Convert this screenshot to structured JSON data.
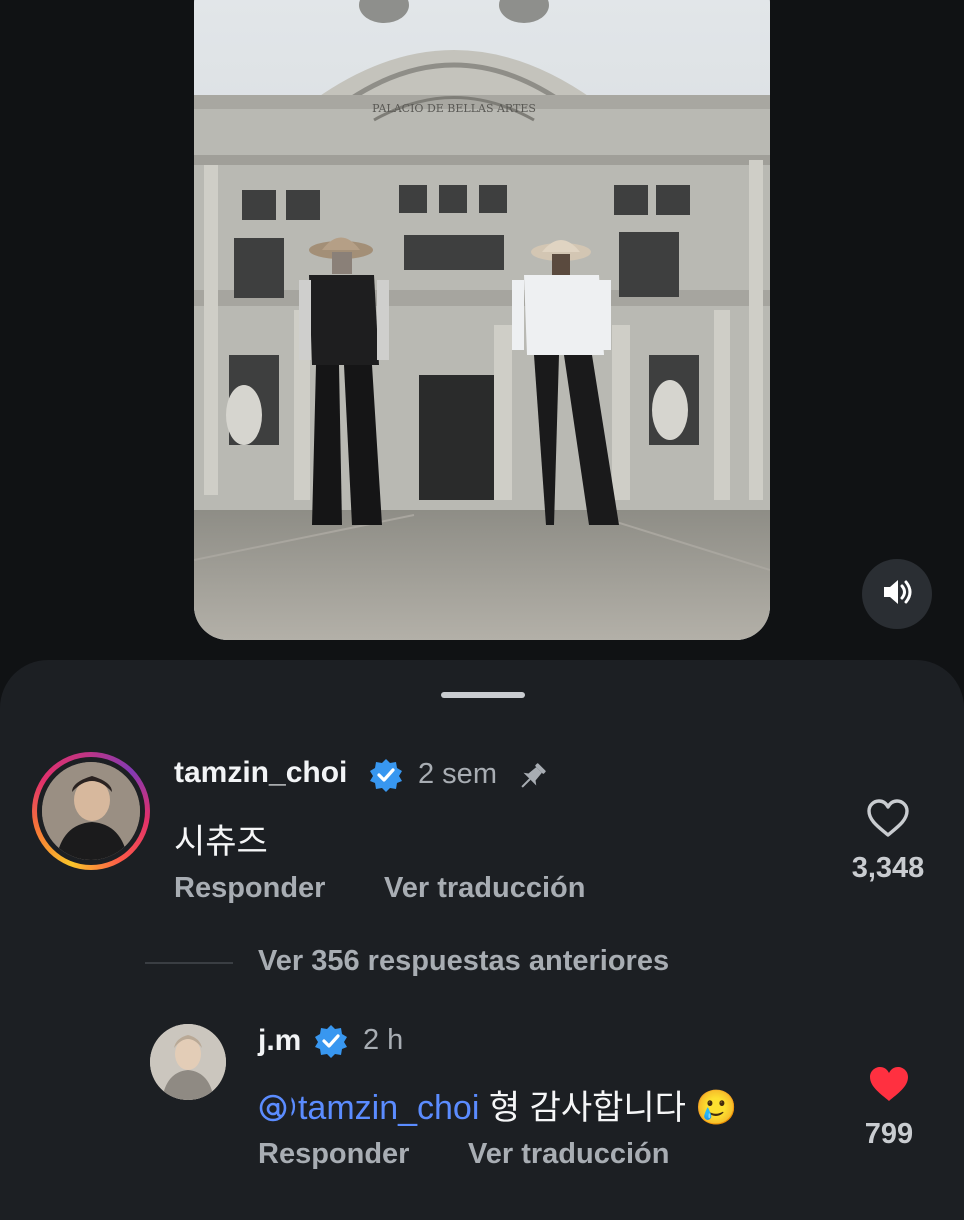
{
  "video": {
    "building_sign": "PALACIO DE BELLAS ARTES",
    "sound_icon": "speaker-on-icon"
  },
  "colors": {
    "background": "#101214",
    "sheet": "#1c1f23",
    "verified": "#3897f0",
    "mention": "#5b8cff",
    "liked_heart": "#ff3040"
  },
  "comment": {
    "username": "tamzin_choi",
    "time": "2 sem",
    "text": "시츄즈",
    "reply_label": "Responder",
    "translate_label": "Ver traducción",
    "like_count": "3,348",
    "icons": [
      "verified-badge-icon",
      "pin-icon",
      "heart-outline-icon"
    ]
  },
  "view_replies": {
    "label": "Ver 356 respuestas anteriores"
  },
  "reply": {
    "username": "j.m",
    "time": "2 h",
    "mention": "@tamzin_choi",
    "text": " 형 감사합니다 🥲",
    "reply_label": "Responder",
    "translate_label": "Ver traducción",
    "like_count": "799",
    "icons": [
      "verified-badge-icon",
      "threads-at-icon",
      "heart-filled-icon"
    ]
  }
}
